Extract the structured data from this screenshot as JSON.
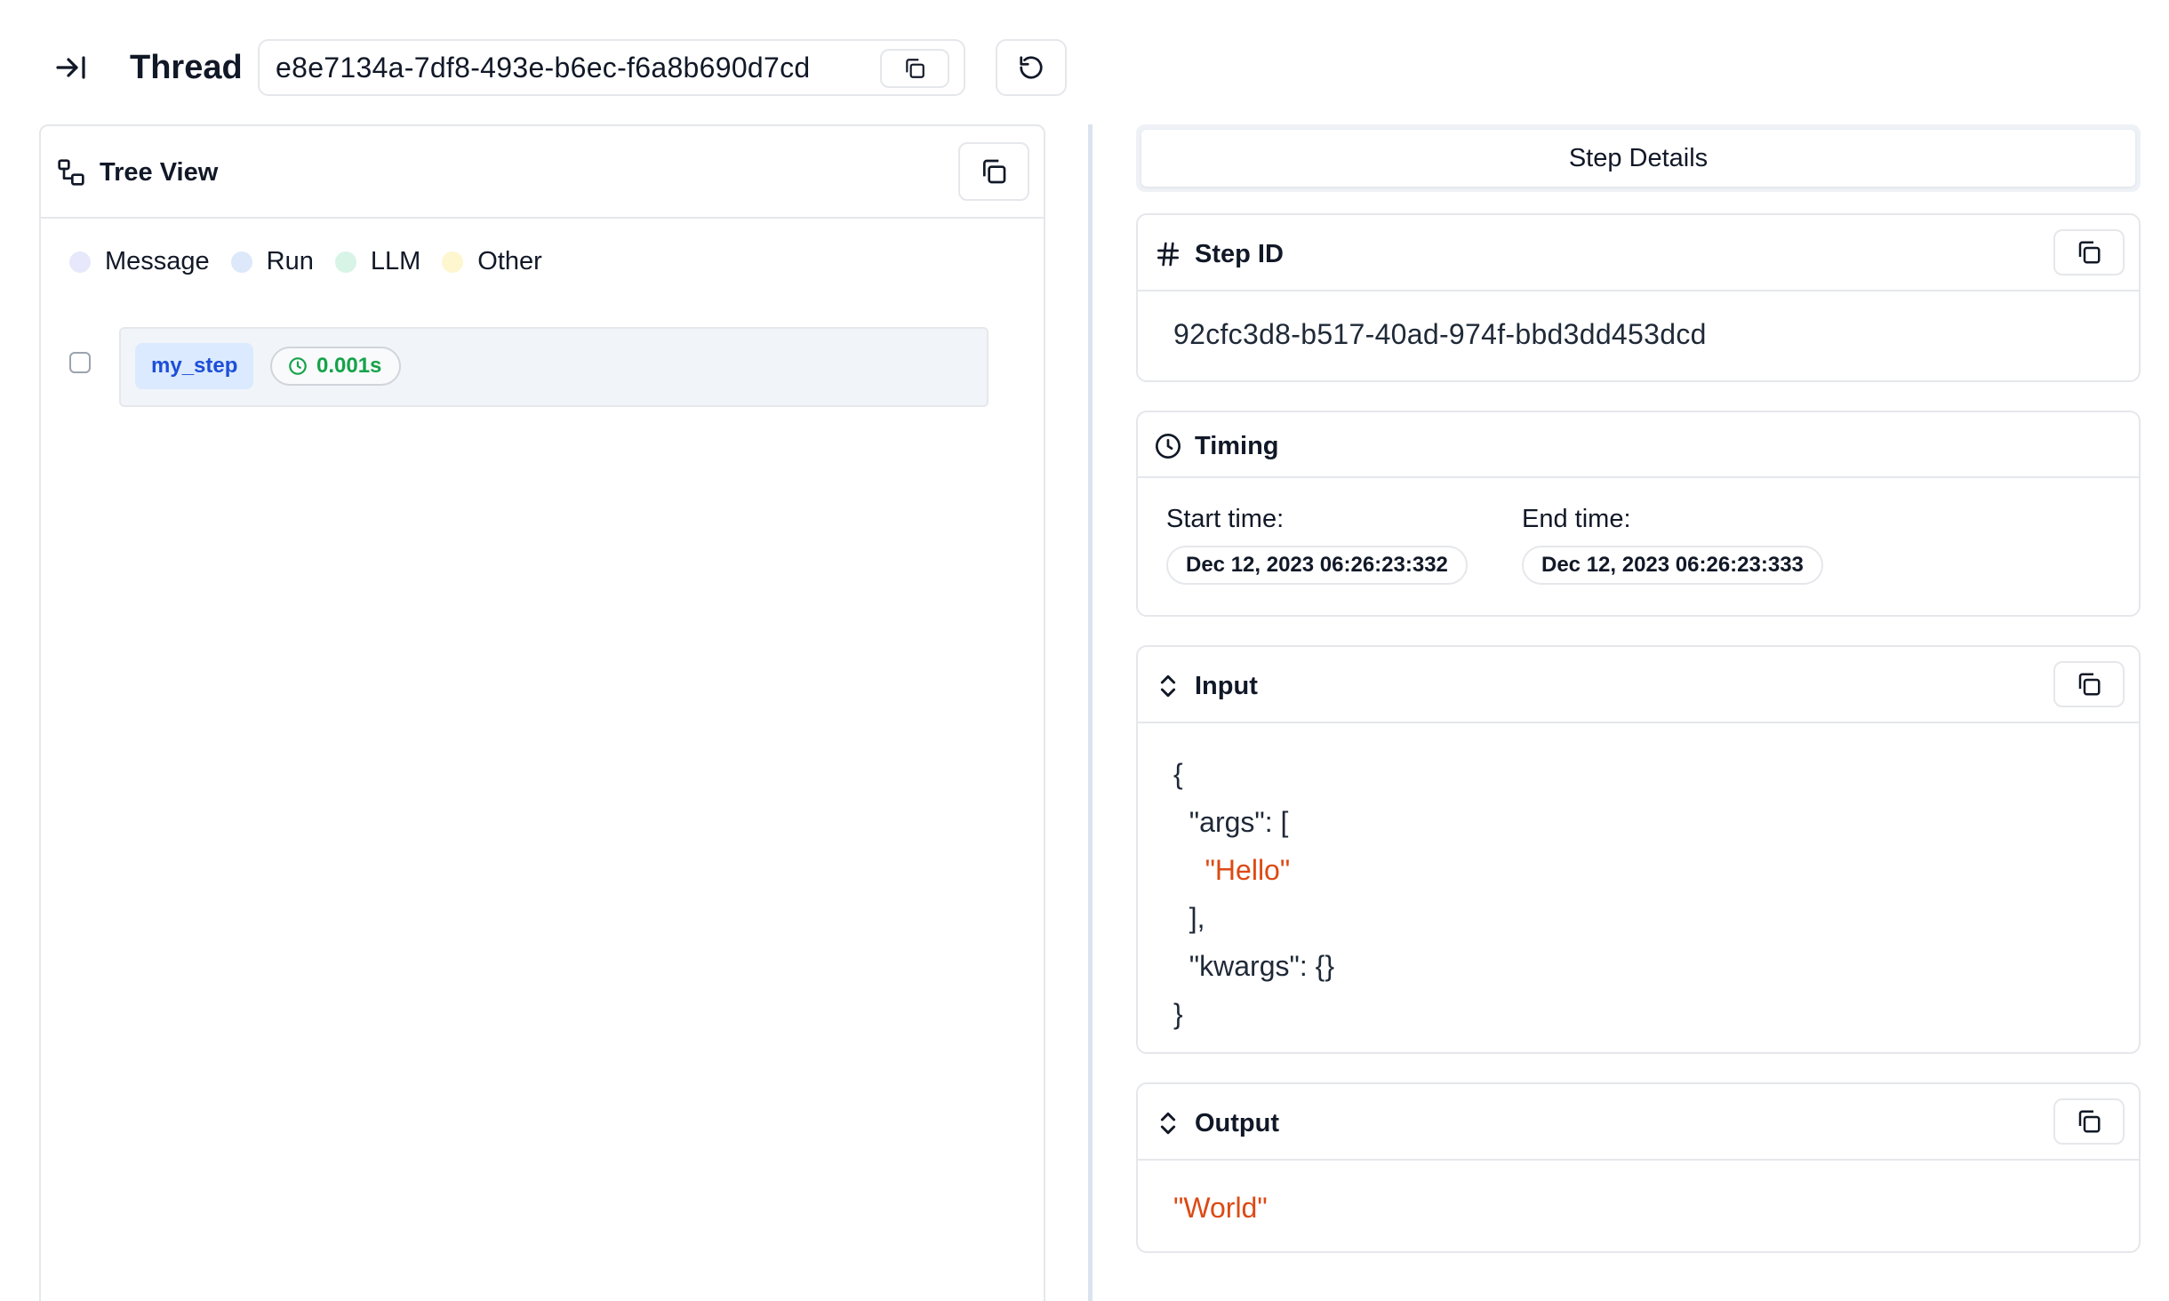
{
  "header": {
    "title": "Thread",
    "thread_id": "e8e7134a-7df8-493e-b6ec-f6a8b690d7cd",
    "icons": {
      "collapse": "arrow-right-to-line-icon",
      "copy": "copy-icon",
      "refresh": "refresh-icon"
    }
  },
  "tree_view": {
    "title": "Tree View",
    "legend": [
      {
        "label": "Message",
        "color": "#e7e8fb"
      },
      {
        "label": "Run",
        "color": "#dde8fb"
      },
      {
        "label": "LLM",
        "color": "#d7f4e6"
      },
      {
        "label": "Other",
        "color": "#fdf6cf"
      }
    ],
    "steps": [
      {
        "name": "my_step",
        "duration": "0.001s"
      }
    ]
  },
  "details": {
    "tab_label": "Step Details",
    "step_id": {
      "title": "Step ID",
      "value": "92cfc3d8-b517-40ad-974f-bbd3dd453dcd"
    },
    "timing": {
      "title": "Timing",
      "start_label": "Start time:",
      "start_value": "Dec 12, 2023 06:26:23:332",
      "end_label": "End time:",
      "end_value": "Dec 12, 2023 06:26:23:333"
    },
    "input": {
      "title": "Input",
      "lines": [
        "{",
        "  \"args\": [",
        "    \"Hello\"",
        "  ],",
        "  \"kwargs\": {}",
        "}"
      ]
    },
    "output": {
      "title": "Output",
      "value": "\"World\""
    }
  }
}
